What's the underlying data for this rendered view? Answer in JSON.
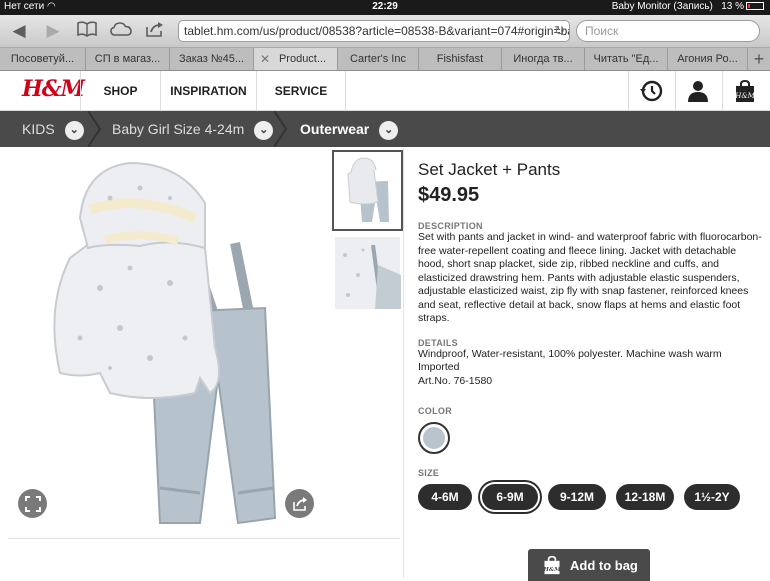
{
  "status": {
    "carrier": "Нет сети",
    "time": "22:29",
    "recording": "Baby Monitor (Запись)",
    "battery": "13 %"
  },
  "browser": {
    "url": "tablet.hm.com/us/product/08538?article=08538-B&variant=074#origin=ba",
    "search_placeholder": "Поиск",
    "tabs": [
      {
        "label": "Посоветуй..."
      },
      {
        "label": "СП в магаз..."
      },
      {
        "label": "Заказ №45..."
      },
      {
        "label": "Product..."
      },
      {
        "label": "Carter's Inc"
      },
      {
        "label": "Fishisfast"
      },
      {
        "label": "Иногда тв..."
      },
      {
        "label": "Читать \"Ед..."
      },
      {
        "label": "Агония Ро..."
      }
    ],
    "new_tab": "+"
  },
  "header": {
    "logo": "H&M",
    "nav": [
      {
        "label": "SHOP"
      },
      {
        "label": "INSPIRATION"
      },
      {
        "label": "SERVICE"
      }
    ]
  },
  "breadcrumb": [
    {
      "label": "KIDS"
    },
    {
      "label": "Baby Girl Size 4-24m"
    },
    {
      "label": "Outerwear"
    }
  ],
  "product": {
    "title": "Set Jacket + Pants",
    "price": "$49.95",
    "description_label": "DESCRIPTION",
    "description": "Set with pants and jacket in wind- and waterproof fabric with fluorocarbon-free water-repellent coating and fleece lining. Jacket with detachable hood, short snap placket, side zip, ribbed neckline and cuffs, and elasticized drawstring hem. Pants with adjustable elastic suspenders, adjustable elasticized waist, zip fly with snap fastener, reinforced knees and seat, reflective detail at back, snow flaps at hems and elastic foot straps.",
    "details_label": "DETAILS",
    "details_1": "Windproof, Water-resistant, 100% polyester. Machine wash warm",
    "details_2": "Imported",
    "details_3": "Art.No. 76-1580",
    "color_label": "COLOR",
    "size_label": "SIZE",
    "sizes": [
      {
        "label": "4-6M"
      },
      {
        "label": "6-9M"
      },
      {
        "label": "9-12M"
      },
      {
        "label": "12-18M"
      },
      {
        "label": "1½-2Y"
      }
    ],
    "selected_size": "6-9M",
    "add_to_bag": "Add to bag"
  },
  "colors": {
    "accent": "#d0021b",
    "dark": "#2d2d2d",
    "breadcrumb_bg": "#4a4a4a"
  }
}
